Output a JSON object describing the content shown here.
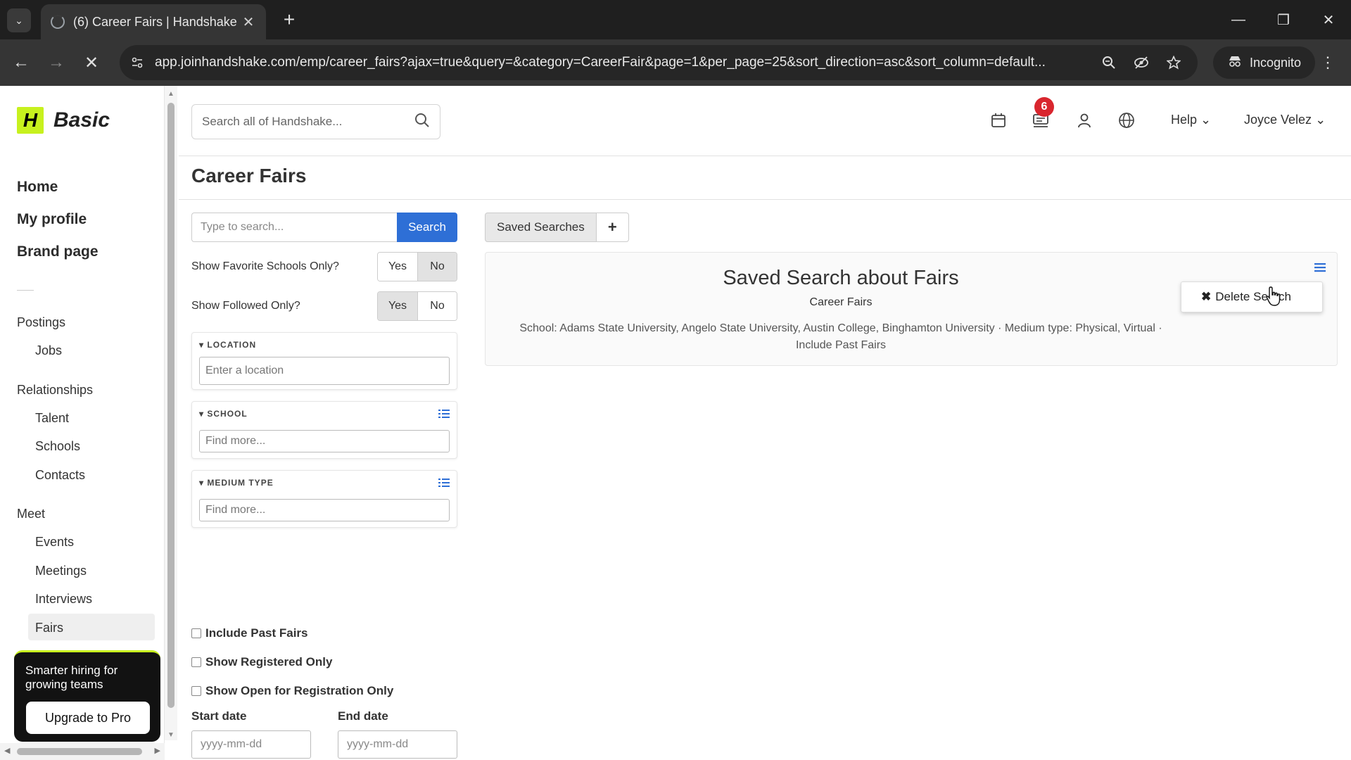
{
  "browser": {
    "tab_title": "(6) Career Fairs | Handshake",
    "url": "app.joinhandshake.com/emp/career_fairs?ajax=true&query=&category=CareerFair&page=1&per_page=25&sort_direction=asc&sort_column=default...",
    "incognito_label": "Incognito"
  },
  "sidebar": {
    "logo_text": "Basic",
    "logo_mark": "H",
    "primary": [
      "Home",
      "My profile",
      "Brand page"
    ],
    "postings_label": "Postings",
    "postings_items": [
      "Jobs"
    ],
    "relationships_label": "Relationships",
    "relationships_items": [
      "Talent",
      "Schools",
      "Contacts"
    ],
    "meet_label": "Meet",
    "meet_items": [
      "Events",
      "Meetings",
      "Interviews",
      "Fairs"
    ],
    "active_item": "Fairs",
    "promo_text": "Smarter hiring for growing teams",
    "promo_button": "Upgrade to Pro"
  },
  "header": {
    "search_placeholder": "Search all of Handshake...",
    "notification_count": "6",
    "help_label": "Help",
    "user_name": "Joyce Velez"
  },
  "page": {
    "title": "Career Fairs"
  },
  "filters": {
    "search_placeholder": "Type to search...",
    "search_button": "Search",
    "favorite_schools_label": "Show Favorite Schools Only?",
    "favorite_schools_value": "No",
    "followed_label": "Show Followed Only?",
    "followed_value": "Yes",
    "yes_label": "Yes",
    "no_label": "No",
    "location_header": "LOCATION",
    "location_placeholder": "Enter a location",
    "school_header": "SCHOOL",
    "school_placeholder": "Find more...",
    "medium_header": "MEDIUM TYPE",
    "medium_placeholder": "Find more...",
    "checkboxes": [
      "Include Past Fairs",
      "Show Registered Only",
      "Show Open for Registration Only"
    ],
    "start_date_label": "Start date",
    "end_date_label": "End date",
    "date_placeholder": "yyyy-mm-dd"
  },
  "saved_searches": {
    "tab_label": "Saved Searches",
    "add_label": "+",
    "card_title": "Saved Search about Fairs",
    "card_subtitle": "Career Fairs",
    "criteria_line1": "School: Adams State University, Angelo State University, Austin College, Binghamton University · Medium type: Physical, Virtual ·",
    "criteria_line2": "Include Past Fairs",
    "menu_item": "Delete Search"
  },
  "colors": {
    "brand_lime": "#c7f11e",
    "primary_blue": "#2e6fd6",
    "badge_red": "#d9262e"
  }
}
